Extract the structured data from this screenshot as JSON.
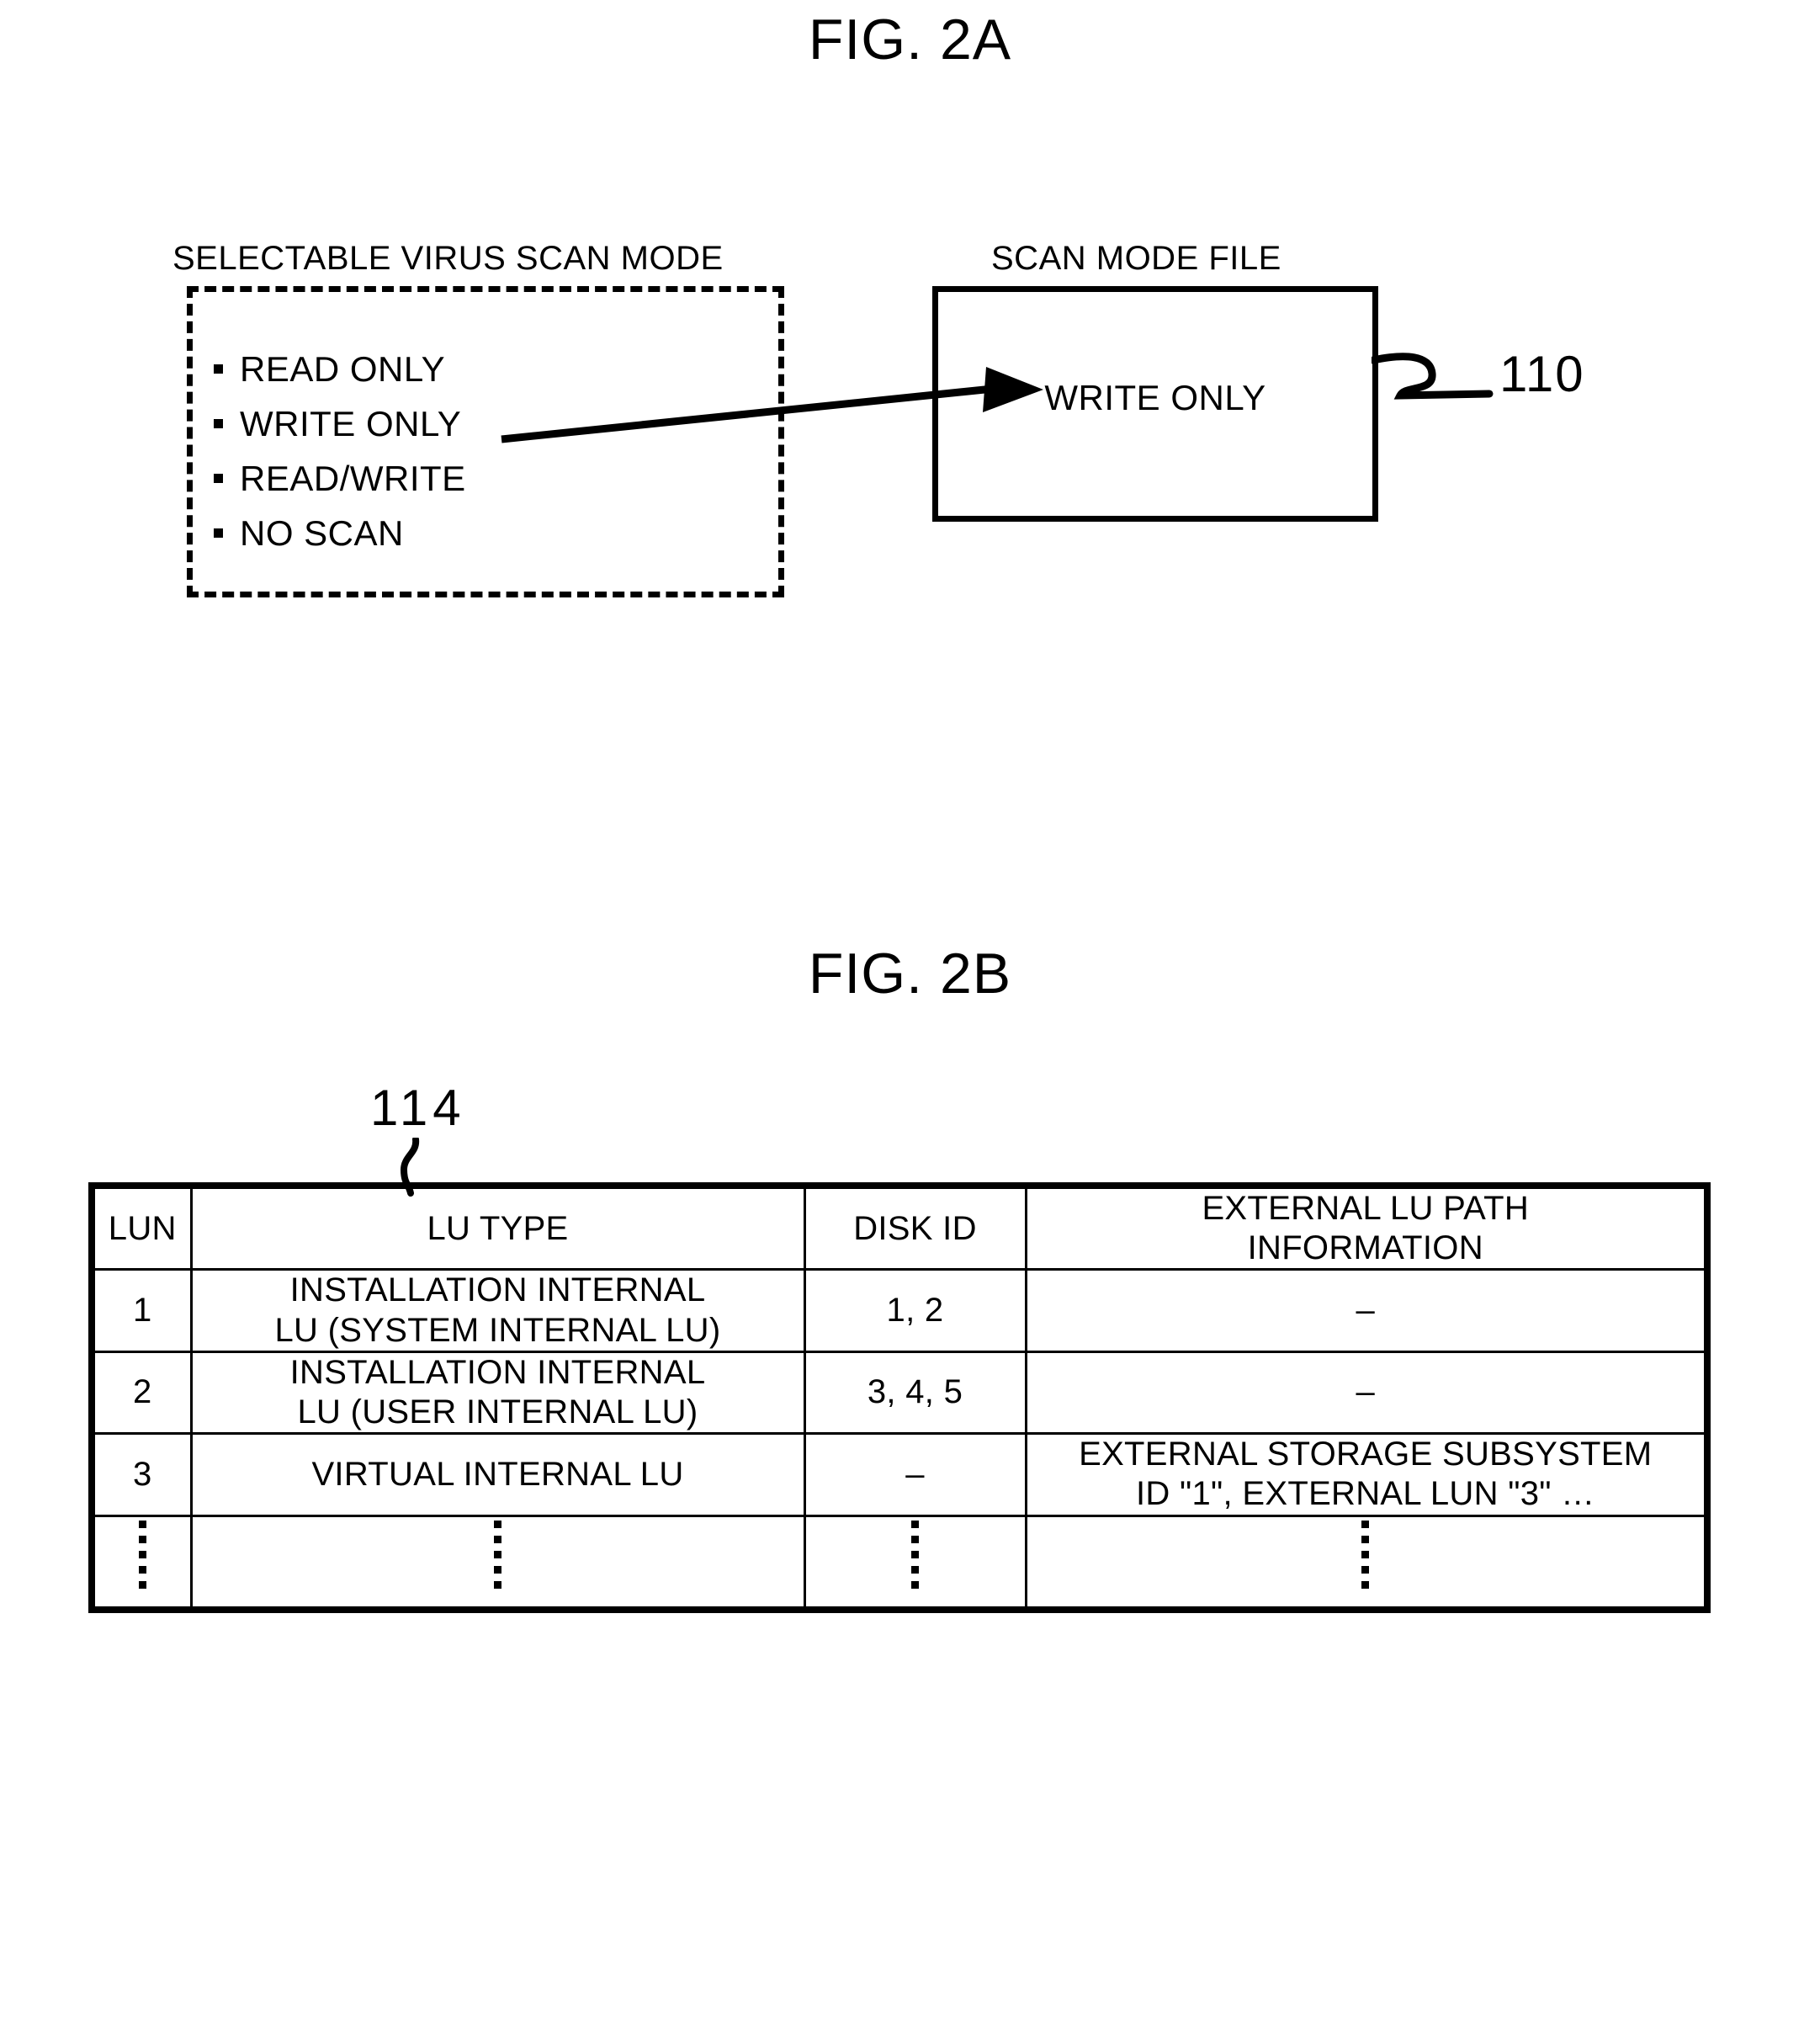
{
  "figures": {
    "fig_a": {
      "title": "FIG. 2A",
      "selectable_caption": "SELECTABLE VIRUS SCAN MODE",
      "modes": [
        "READ ONLY",
        "WRITE ONLY",
        "READ/WRITE",
        "NO SCAN"
      ],
      "scan_mode_file_caption": "SCAN MODE FILE",
      "scan_mode_file_value": "WRITE ONLY",
      "reference_numeral": "110"
    },
    "fig_b": {
      "title": "FIG. 2B",
      "reference_numeral": "114",
      "table": {
        "headers": [
          "LUN",
          "LU TYPE",
          "DISK ID",
          [
            "EXTERNAL LU PATH",
            "INFORMATION"
          ]
        ],
        "rows": [
          {
            "lun": "1",
            "lu_type": [
              "INSTALLATION INTERNAL",
              "LU (SYSTEM INTERNAL LU)"
            ],
            "disk_id": "1, 2",
            "external_lu_path": [
              "–"
            ]
          },
          {
            "lun": "2",
            "lu_type": [
              "INSTALLATION INTERNAL",
              "LU (USER INTERNAL LU)"
            ],
            "disk_id": "3, 4, 5",
            "external_lu_path": [
              "–"
            ]
          },
          {
            "lun": "3",
            "lu_type": [
              "VIRTUAL INTERNAL LU"
            ],
            "disk_id": "–",
            "external_lu_path": [
              "EXTERNAL STORAGE SUBSYSTEM",
              "ID \"1\", EXTERNAL LUN \"3\" …"
            ]
          }
        ],
        "continuation_row": "vertical-ellipsis"
      }
    }
  },
  "colors": {
    "ink": "#000000",
    "background": "#ffffff"
  }
}
